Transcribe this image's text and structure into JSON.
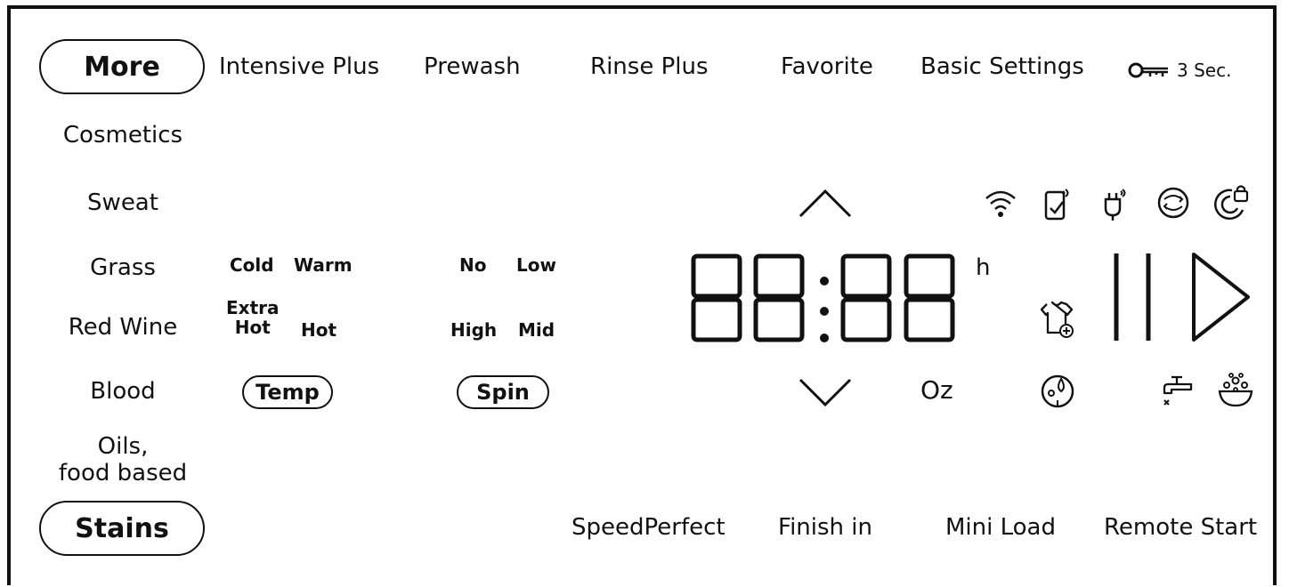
{
  "top_row": {
    "more_label": "More",
    "intensive_plus": "Intensive Plus",
    "prewash": "Prewash",
    "rinse_plus": "Rinse Plus",
    "favorite": "Favorite",
    "basic_settings": "Basic Settings",
    "lock_hold": "3 Sec."
  },
  "stains": {
    "items": [
      "Cosmetics",
      "Sweat",
      "Grass",
      "Red Wine",
      "Blood"
    ],
    "oils_line1": "Oils,",
    "oils_line2": "food based",
    "button_label": "Stains"
  },
  "temp": {
    "cold": "Cold",
    "warm": "Warm",
    "extra_hot_line1": "Extra",
    "extra_hot_line2": "Hot",
    "hot": "Hot",
    "button_label": "Temp"
  },
  "spin": {
    "no": "No",
    "low": "Low",
    "high": "High",
    "mid": "Mid",
    "button_label": "Spin"
  },
  "display": {
    "unit_hours": "h",
    "unit_oz": "Oz"
  },
  "bottom_row": {
    "speed_perfect": "SpeedPerfect",
    "finish_in": "Finish in",
    "mini_load": "Mini Load",
    "remote_start": "Remote Start"
  },
  "icons": [
    "key-icon",
    "wifi-icon",
    "phone-download-icon",
    "remote-plug-icon",
    "drum-clean-icon",
    "child-lock-icon",
    "shirt-add-icon",
    "pause-icon",
    "play-icon",
    "detergent-icon",
    "no-water-icon",
    "basin-bubbles-icon",
    "arrow-up-icon",
    "arrow-down-icon"
  ]
}
